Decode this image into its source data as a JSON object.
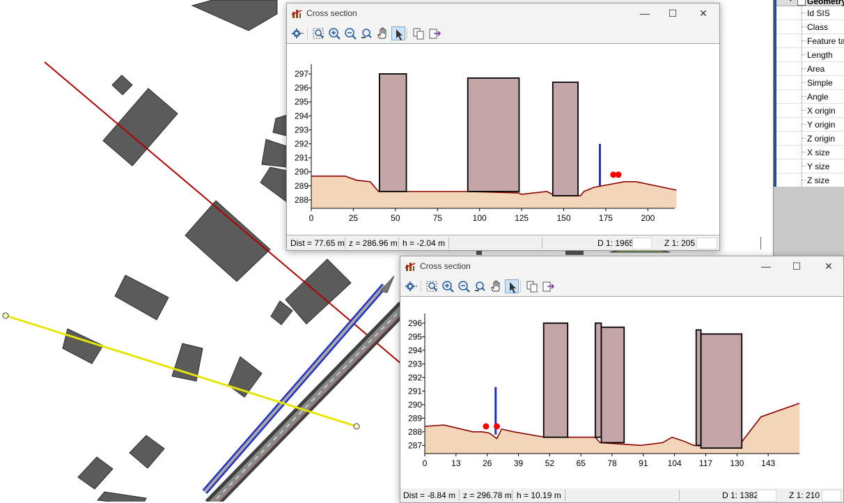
{
  "colors": {
    "building": "#5b5b5b",
    "road_red": "#b00000",
    "road_yellow": "#e6e600",
    "road_blue": "#1f2fbf",
    "terrain_fill": "#f2d6b7",
    "terrain_line": "#8b0000",
    "section_building": "#c4a6a6",
    "marker_red": "#ff0000"
  },
  "panel": {
    "header": "Geometry",
    "items": [
      "Id SIS",
      "Class",
      "Feature tab",
      "Length",
      "Area",
      "Simple",
      "Angle",
      "X origin",
      "Y origin",
      "Z origin",
      "X size",
      "Y size",
      "Z size"
    ]
  },
  "windows": [
    {
      "title": "Cross section",
      "controls": {
        "minimize": "—",
        "maximize": "☐",
        "close": "✕"
      },
      "toolbar": [
        "settings-icon",
        "zoom-extent-icon",
        "zoom-in-icon",
        "zoom-out-icon",
        "zoom-previous-icon",
        "pan-hand-icon",
        "select-arrow-icon",
        "copy-icon",
        "export-icon"
      ],
      "status": {
        "dist": "Dist = 77.65 m",
        "z": "z = 286.96 m",
        "h": "h = -2.04 m",
        "d_scale": "D  1: 1965",
        "z_scale": "Z  1: 205"
      },
      "chart_data": {
        "type": "area",
        "title": "",
        "xlabel": "",
        "ylabel": "",
        "xlim": [
          0,
          216
        ],
        "ylim": [
          287.4,
          297.4
        ],
        "x_ticks": [
          "0",
          "25",
          "50",
          "75",
          "100",
          "125",
          "150",
          "175",
          "200"
        ],
        "y_ticks": [
          "288",
          "289",
          "290",
          "291",
          "292",
          "293",
          "294",
          "295",
          "296",
          "297"
        ],
        "terrain": [
          [
            0,
            289.7
          ],
          [
            20,
            289.7
          ],
          [
            27,
            289.4
          ],
          [
            35,
            289.3
          ],
          [
            40,
            288.6
          ],
          [
            93,
            288.6
          ],
          [
            123,
            288.5
          ],
          [
            125,
            288.4
          ],
          [
            140,
            288.6
          ],
          [
            145,
            288.3
          ],
          [
            160,
            288.3
          ],
          [
            162,
            288.6
          ],
          [
            168,
            288.9
          ],
          [
            186,
            289.3
          ],
          [
            193,
            289.3
          ],
          [
            217,
            288.7
          ]
        ],
        "buildings": [
          {
            "x0": 40.5,
            "x1": 56.5,
            "base": 288.6,
            "top": 297.0
          },
          {
            "x0": 93.0,
            "x1": 123.5,
            "base": 288.6,
            "top": 296.7
          },
          {
            "x0": 143.5,
            "x1": 158.5,
            "base": 288.3,
            "top": 296.4
          }
        ],
        "pole": {
          "x": 171.5,
          "base": 289.0,
          "top": 292.0
        },
        "markers": [
          [
            179.5,
            289.8
          ],
          [
            182.5,
            289.8
          ]
        ]
      }
    },
    {
      "title": "Cross section",
      "controls": {
        "minimize": "—",
        "maximize": "☐",
        "close": "✕"
      },
      "toolbar": [
        "settings-icon",
        "zoom-extent-icon",
        "zoom-in-icon",
        "zoom-out-icon",
        "zoom-previous-icon",
        "pan-hand-icon",
        "select-arrow-icon",
        "copy-icon",
        "export-icon"
      ],
      "status": {
        "dist": "Dist = -8.84 m",
        "z": "z = 296.78 m",
        "h": "h = 10.19 m",
        "d_scale": "D  1: 1382",
        "z_scale": "Z  1: 210"
      },
      "chart_data": {
        "type": "area",
        "title": "",
        "xlabel": "",
        "ylabel": "",
        "xlim": [
          0,
          156
        ],
        "ylim": [
          286.4,
          296.4
        ],
        "x_ticks": [
          "0",
          "13",
          "26",
          "39",
          "52",
          "65",
          "78",
          "91",
          "104",
          "117",
          "130",
          "143"
        ],
        "y_ticks": [
          "287",
          "288",
          "289",
          "290",
          "291",
          "292",
          "293",
          "294",
          "295",
          "296"
        ],
        "terrain": [
          [
            0,
            288.4
          ],
          [
            8,
            288.5
          ],
          [
            20,
            288.0
          ],
          [
            24,
            288.0
          ],
          [
            27,
            287.9
          ],
          [
            30,
            287.5
          ],
          [
            32,
            288.2
          ],
          [
            37,
            288.0
          ],
          [
            50,
            287.6
          ],
          [
            54,
            287.6
          ],
          [
            71,
            287.6
          ],
          [
            73,
            287.2
          ],
          [
            90,
            287.0
          ],
          [
            99,
            287.2
          ],
          [
            103,
            287.6
          ],
          [
            108,
            287.3
          ],
          [
            112,
            287.0
          ],
          [
            130,
            286.8
          ],
          [
            140,
            289.1
          ],
          [
            156,
            290.1
          ]
        ],
        "buildings": [
          {
            "x0": 49.5,
            "x1": 59.5,
            "base": 287.6,
            "top": 296.0
          },
          {
            "x0": 71.0,
            "x1": 73.5,
            "base": 287.6,
            "top": 296.0
          },
          {
            "x0": 73.5,
            "x1": 83.0,
            "base": 287.2,
            "top": 295.7
          },
          {
            "x0": 113.0,
            "x1": 115.0,
            "base": 287.0,
            "top": 295.5
          },
          {
            "x0": 115.0,
            "x1": 132.0,
            "base": 286.8,
            "top": 295.2
          }
        ],
        "pole": {
          "x": 29.5,
          "base": 287.8,
          "top": 291.3
        },
        "markers": [
          [
            25.5,
            288.4
          ],
          [
            30.0,
            288.4
          ]
        ]
      }
    }
  ]
}
